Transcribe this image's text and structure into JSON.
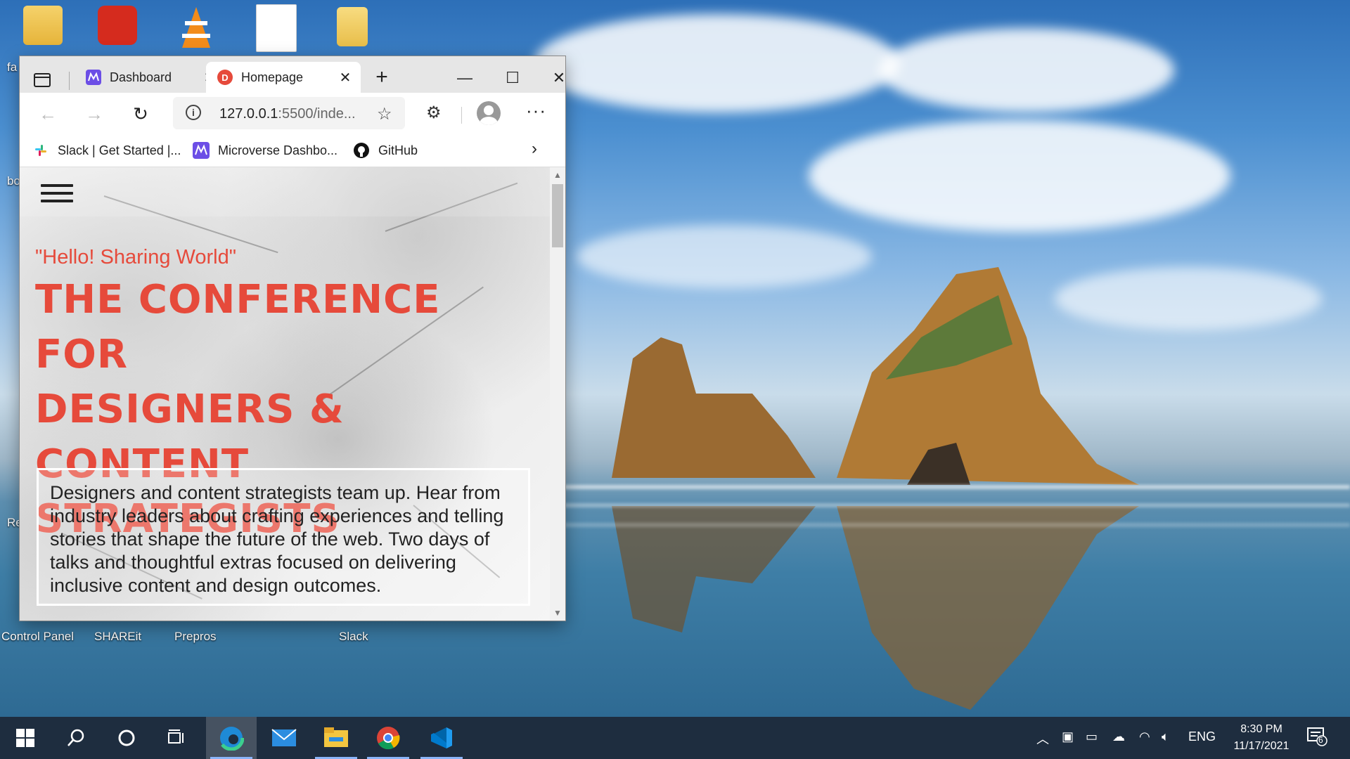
{
  "desktop": {
    "icons": [
      {
        "label": "fa"
      },
      {
        "label": ""
      },
      {
        "label": ""
      },
      {
        "label": ""
      },
      {
        "label": ""
      }
    ],
    "bottom_labels": [
      "Control Panel",
      "SHAREit",
      "Prepros",
      "Slack"
    ],
    "edge_labels": [
      "fa",
      "bo",
      "Re"
    ]
  },
  "browser": {
    "tabs": [
      {
        "label": "Dashboard",
        "icon": "microverse-icon",
        "active": false
      },
      {
        "label": "Homepage",
        "icon": "d-logo-icon",
        "active": true
      }
    ],
    "address": {
      "host": "127.0.0.1",
      "rest": ":5500/inde..."
    },
    "bookmarks": [
      {
        "label": "Slack | Get Started |...",
        "icon": "slack-icon"
      },
      {
        "label": "Microverse Dashbo...",
        "icon": "microverse-icon"
      },
      {
        "label": "GitHub",
        "icon": "github-icon"
      }
    ]
  },
  "page": {
    "tagline": "\"Hello! Sharing World\"",
    "headline_lines": [
      "THE CONFERENCE FOR",
      "DESIGNERS & CONTENT",
      "STRATEGISTS"
    ],
    "description": "Designers and content strategists team up. Hear from industry leaders about crafting experiences and telling stories that shape the future of the web. Two days of talks and thoughtful extras focused on delivering inclusive content and design outcomes."
  },
  "taskbar": {
    "language": "ENG",
    "time": "8:30 PM",
    "date": "11/17/2021",
    "notification_count": "6"
  },
  "colors": {
    "accent": "#e64a3b",
    "taskbar": "#1e2d3f"
  }
}
